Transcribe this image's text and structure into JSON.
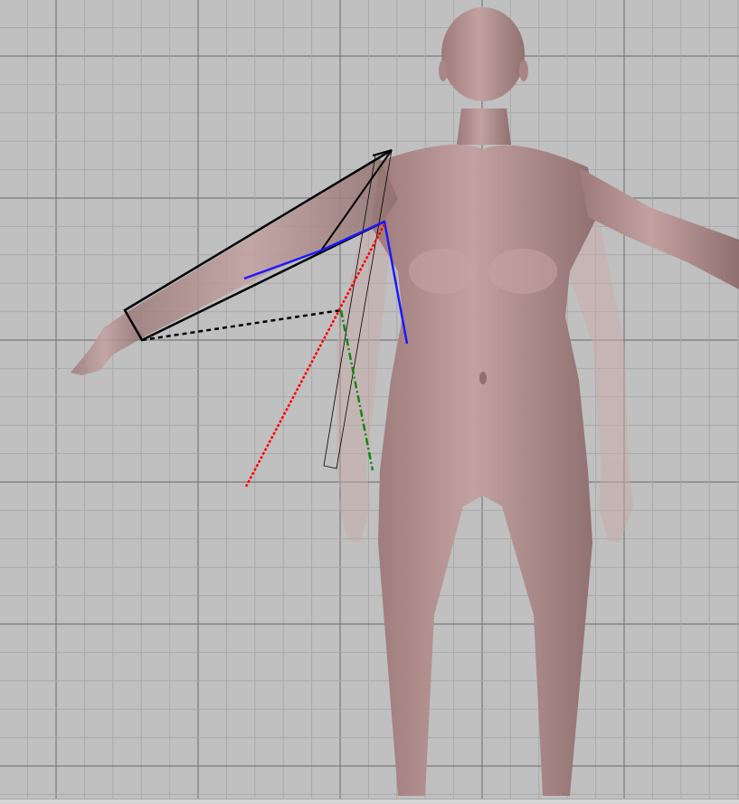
{
  "viewport": {
    "background_color": "#c0c0c0",
    "grid_minor_color": "#a9a9a9",
    "grid_major_color": "#7a7a7a",
    "figure_color": "#b39090",
    "figure_ghost_color": "#c7a9a9"
  },
  "overlay": {
    "outline_color": "#000000",
    "bone_color": "#1a1aff",
    "axis_x_color": "#ff0000",
    "axis_y_color": "#118811"
  }
}
